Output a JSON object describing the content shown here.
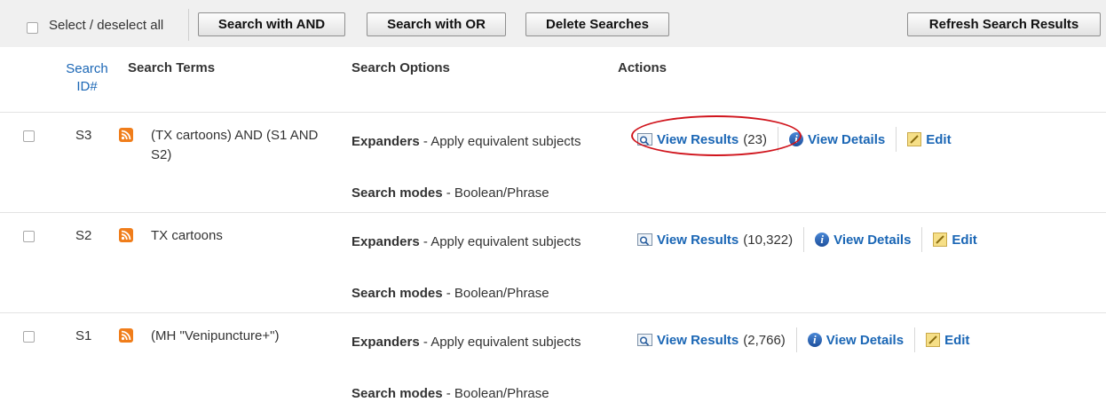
{
  "toolbar": {
    "select_all_label": "Select / deselect all",
    "buttons": [
      {
        "label": "Search with AND"
      },
      {
        "label": "Search with OR"
      },
      {
        "label": "Delete Searches"
      },
      {
        "label": "Refresh Search Results"
      }
    ]
  },
  "columns": {
    "id_line1": "Search",
    "id_line2": "ID#",
    "terms": "Search Terms",
    "options": "Search Options",
    "actions": "Actions"
  },
  "rows": [
    {
      "id": "S3",
      "terms": "(TX cartoons) AND (S1 AND S2)",
      "expanders_label": "Expanders",
      "expanders_value": " - Apply equivalent subjects",
      "modes_label": "Search modes",
      "modes_value": " - Boolean/Phrase",
      "view_results": "View Results",
      "count": "(23)",
      "view_details": "View Details",
      "edit": "Edit"
    },
    {
      "id": "S2",
      "terms": "TX cartoons",
      "expanders_label": "Expanders",
      "expanders_value": " - Apply equivalent subjects",
      "modes_label": "Search modes",
      "modes_value": " - Boolean/Phrase",
      "view_results": "View Results",
      "count": "(10,322)",
      "view_details": "View Details",
      "edit": "Edit"
    },
    {
      "id": "S1",
      "terms": "(MH \"Venipuncture+\")",
      "expanders_label": "Expanders",
      "expanders_value": " - Apply equivalent subjects",
      "modes_label": "Search modes",
      "modes_value": " - Boolean/Phrase",
      "view_results": "View Results",
      "count": "(2,766)",
      "view_details": "View Details",
      "edit": "Edit"
    }
  ],
  "icons": {
    "rss": "rss-feed-icon",
    "view_results": "magnifier-icon",
    "view_details": "info-icon",
    "edit": "pencil-icon"
  },
  "colors": {
    "link": "#1a66b5",
    "highlight_circle": "#d0141c",
    "rss": "#f07d1a",
    "toolbar_bg": "#f0f0f0"
  }
}
